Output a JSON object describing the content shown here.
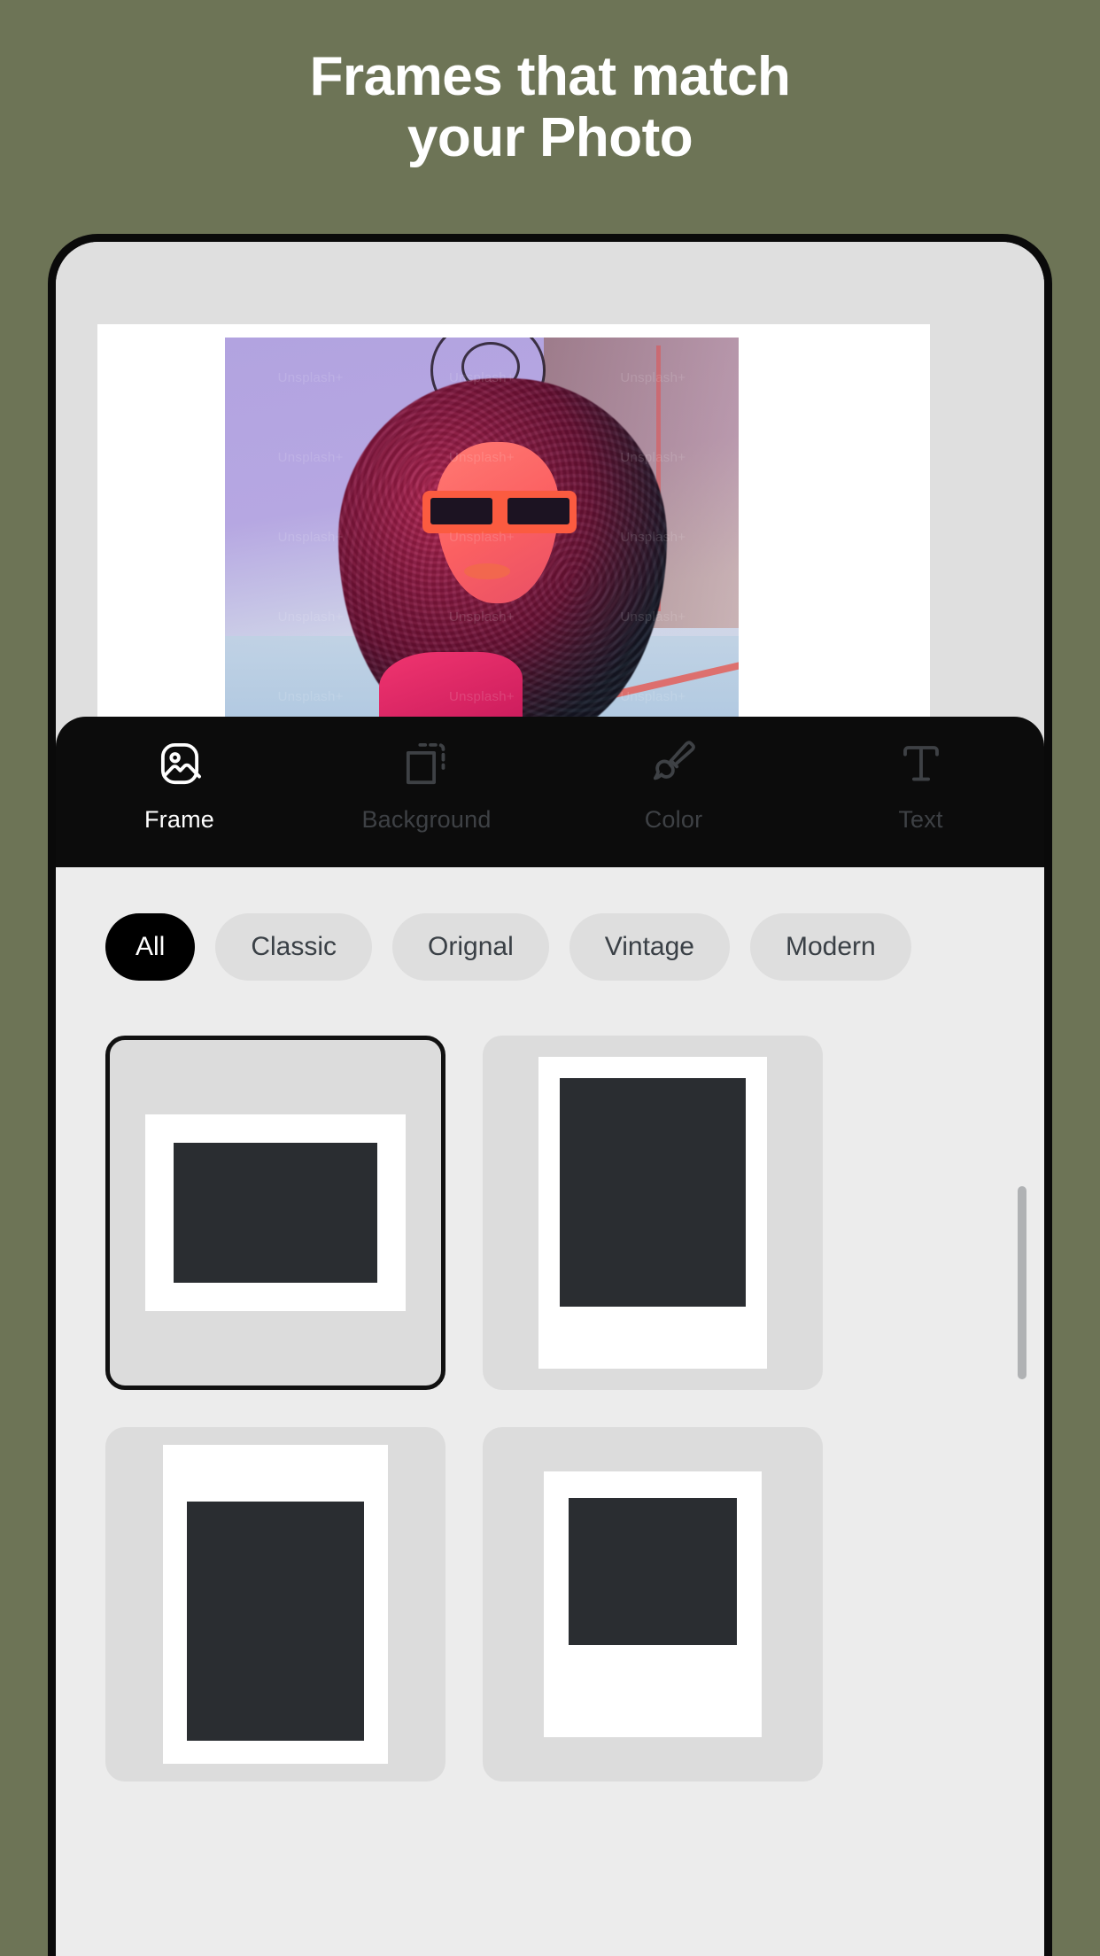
{
  "theme": {
    "page_background": "#6d7456",
    "toolbar_background": "#0c0c0c",
    "panel_background": "#ececec",
    "accent_selected": "#000000",
    "chip_background": "#dedede",
    "card_background": "#dcdcdc",
    "photo_placeholder": "#2a2d31"
  },
  "headline": {
    "line1": "Frames that match",
    "line2": "your Photo"
  },
  "preview": {
    "watermark": "Unsplash+",
    "watermarks": [
      "Unsplash+",
      "Unsplash+",
      "Unsplash+",
      "Unsplash+",
      "Unsplash+",
      "Unsplash+",
      "Unsplash+",
      "Unsplash+",
      "Unsplash+",
      "Unsplash+",
      "Unsplash+",
      "Unsplash+",
      "Unsplash+",
      "Unsplash+",
      "Unsplash+"
    ]
  },
  "toolbar": {
    "tabs": [
      {
        "label": "Frame",
        "icon": "image-icon",
        "active": true
      },
      {
        "label": "Background",
        "icon": "crop-icon",
        "active": false
      },
      {
        "label": "Color",
        "icon": "paintbrush-icon",
        "active": false
      },
      {
        "label": "Text",
        "icon": "text-icon",
        "active": false
      }
    ]
  },
  "panel": {
    "filters": [
      {
        "label": "All",
        "selected": true
      },
      {
        "label": "Classic",
        "selected": false
      },
      {
        "label": "Orignal",
        "selected": false
      },
      {
        "label": "Vintage",
        "selected": false
      },
      {
        "label": "Modern",
        "selected": false
      }
    ],
    "frames": [
      {
        "name": "frame-1",
        "selected": true
      },
      {
        "name": "frame-2",
        "selected": false
      },
      {
        "name": "frame-3",
        "selected": false
      },
      {
        "name": "frame-4",
        "selected": false
      }
    ]
  }
}
